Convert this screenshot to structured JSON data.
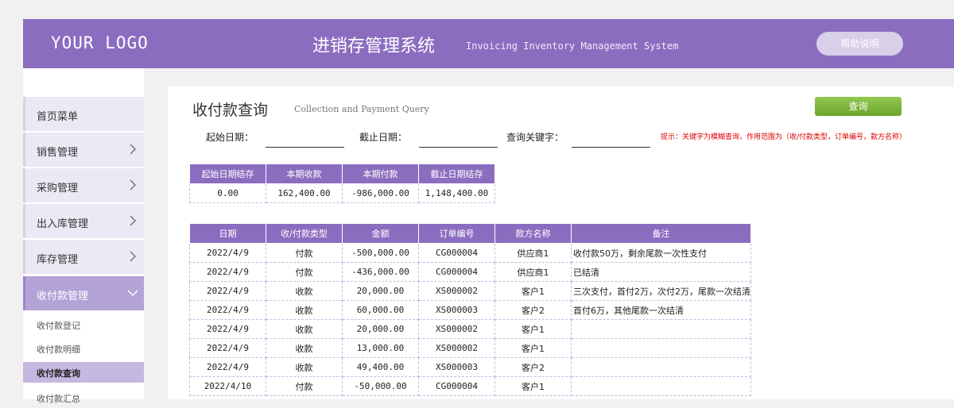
{
  "header": {
    "logo": "YOUR LOGO",
    "title": "进销存管理系统",
    "subtitle": "Invoicing Inventory Management System",
    "help_label": "帮助说明"
  },
  "sidebar": {
    "items": [
      {
        "label": "首页菜单"
      },
      {
        "label": "销售管理"
      },
      {
        "label": "采购管理"
      },
      {
        "label": "出入库管理"
      },
      {
        "label": "库存管理"
      },
      {
        "label": "收付款管理"
      }
    ],
    "sub_items": [
      {
        "label": "收付款登记"
      },
      {
        "label": "收付款明细"
      },
      {
        "label": "收付款查询"
      },
      {
        "label": "收付款汇总"
      }
    ]
  },
  "page": {
    "title": "收付款查询",
    "subtitle": "Collection and Payment Query",
    "query_label": "查询"
  },
  "filters": {
    "start_label": "起始日期：",
    "end_label": "截止日期：",
    "keyword_label": "查询关键字：",
    "start_value": "",
    "end_value": "",
    "keyword_value": "",
    "tip": "提示：关键字为模糊查询，作用范围为（收/付款类型，订单编号，款方名称）"
  },
  "summary": {
    "headers": [
      "起始日期结存",
      "本期收款",
      "本期付款",
      "截止日期结存"
    ],
    "values": [
      "0.00",
      "162,400.00",
      "-986,000.00",
      "1,148,400.00"
    ]
  },
  "detail": {
    "headers": [
      "日期",
      "收/付款类型",
      "金额",
      "订单编号",
      "款方名称",
      "备注"
    ],
    "rows": [
      [
        "2022/4/9",
        "付款",
        "-500,000.00",
        "CG000004",
        "供应商1",
        "收付款50万，剩余尾款一次性支付"
      ],
      [
        "2022/4/9",
        "付款",
        "-436,000.00",
        "CG000004",
        "供应商1",
        "已结清"
      ],
      [
        "2022/4/9",
        "收款",
        "20,000.00",
        "XS000002",
        "客户1",
        "三次支付，首付2万，次付2万，尾款一次结清"
      ],
      [
        "2022/4/9",
        "收款",
        "60,000.00",
        "XS000003",
        "客户2",
        "首付6万，其他尾款一次结清"
      ],
      [
        "2022/4/9",
        "收款",
        "20,000.00",
        "XS000002",
        "客户1",
        ""
      ],
      [
        "2022/4/9",
        "收款",
        "13,000.00",
        "XS000002",
        "客户1",
        ""
      ],
      [
        "2022/4/9",
        "收款",
        "49,400.00",
        "XS000003",
        "客户2",
        ""
      ],
      [
        "2022/4/10",
        "付款",
        "-50,000.00",
        "CG000004",
        "客户1",
        ""
      ]
    ]
  }
}
